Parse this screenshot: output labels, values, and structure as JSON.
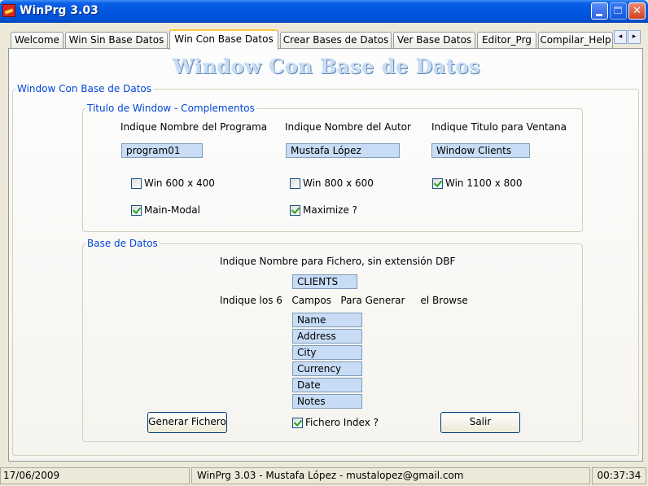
{
  "window": {
    "title": "WinPrg 3.03"
  },
  "tabs": [
    {
      "label": "Welcome"
    },
    {
      "label": "Win Sin Base Datos"
    },
    {
      "label": "Win Con Base Datos"
    },
    {
      "label": "Crear Bases de Datos"
    },
    {
      "label": "Ver Base Datos"
    },
    {
      "label": "Editor_Prg"
    },
    {
      "label": "Compilar_Help"
    }
  ],
  "tab_scroll": {
    "left": "◂",
    "right": "▸"
  },
  "page": {
    "heading": "Window Con Base de Datos",
    "outer_group": "Window Con Base de Datos",
    "titulo_group": {
      "legend": "Titulo de Window - Complementos",
      "program_label": "Indique Nombre del Programa",
      "program_value": "program01",
      "author_label": "Indique Nombre del  Autor",
      "author_value": "Mustafa López",
      "window_title_label": "Indique Titulo para  Ventana",
      "window_title_value": "Window Clients",
      "win600": {
        "label": "Win 600 x 400",
        "checked": false
      },
      "win800": {
        "label": "Win 800 x 600",
        "checked": false
      },
      "win1100": {
        "label": "Win 1100 x 800",
        "checked": true
      },
      "main_modal": {
        "label": "Main-Modal",
        "checked": true
      },
      "maximize": {
        "label": "Maximize ?",
        "checked": true
      }
    },
    "db_group": {
      "legend": "Base de Datos",
      "file_label": "Indique Nombre para Fichero, sin extensión  DBF",
      "file_value": "CLIENTS",
      "fields_label": "Indique los 6   Campos   Para Generar     el Browse",
      "fields": [
        "Name",
        "Address",
        "City",
        "Currency",
        "Date",
        "Notes"
      ],
      "generate_button": "Generar Fichero",
      "index": {
        "label": "Fichero Index ?",
        "checked": true
      },
      "exit_button": "Salir"
    }
  },
  "statusbar": {
    "date": "17/06/2009",
    "info": "WinPrg 3.03 - Mustafa López - mustalopez@gmail.com",
    "time": "00:37:34"
  }
}
